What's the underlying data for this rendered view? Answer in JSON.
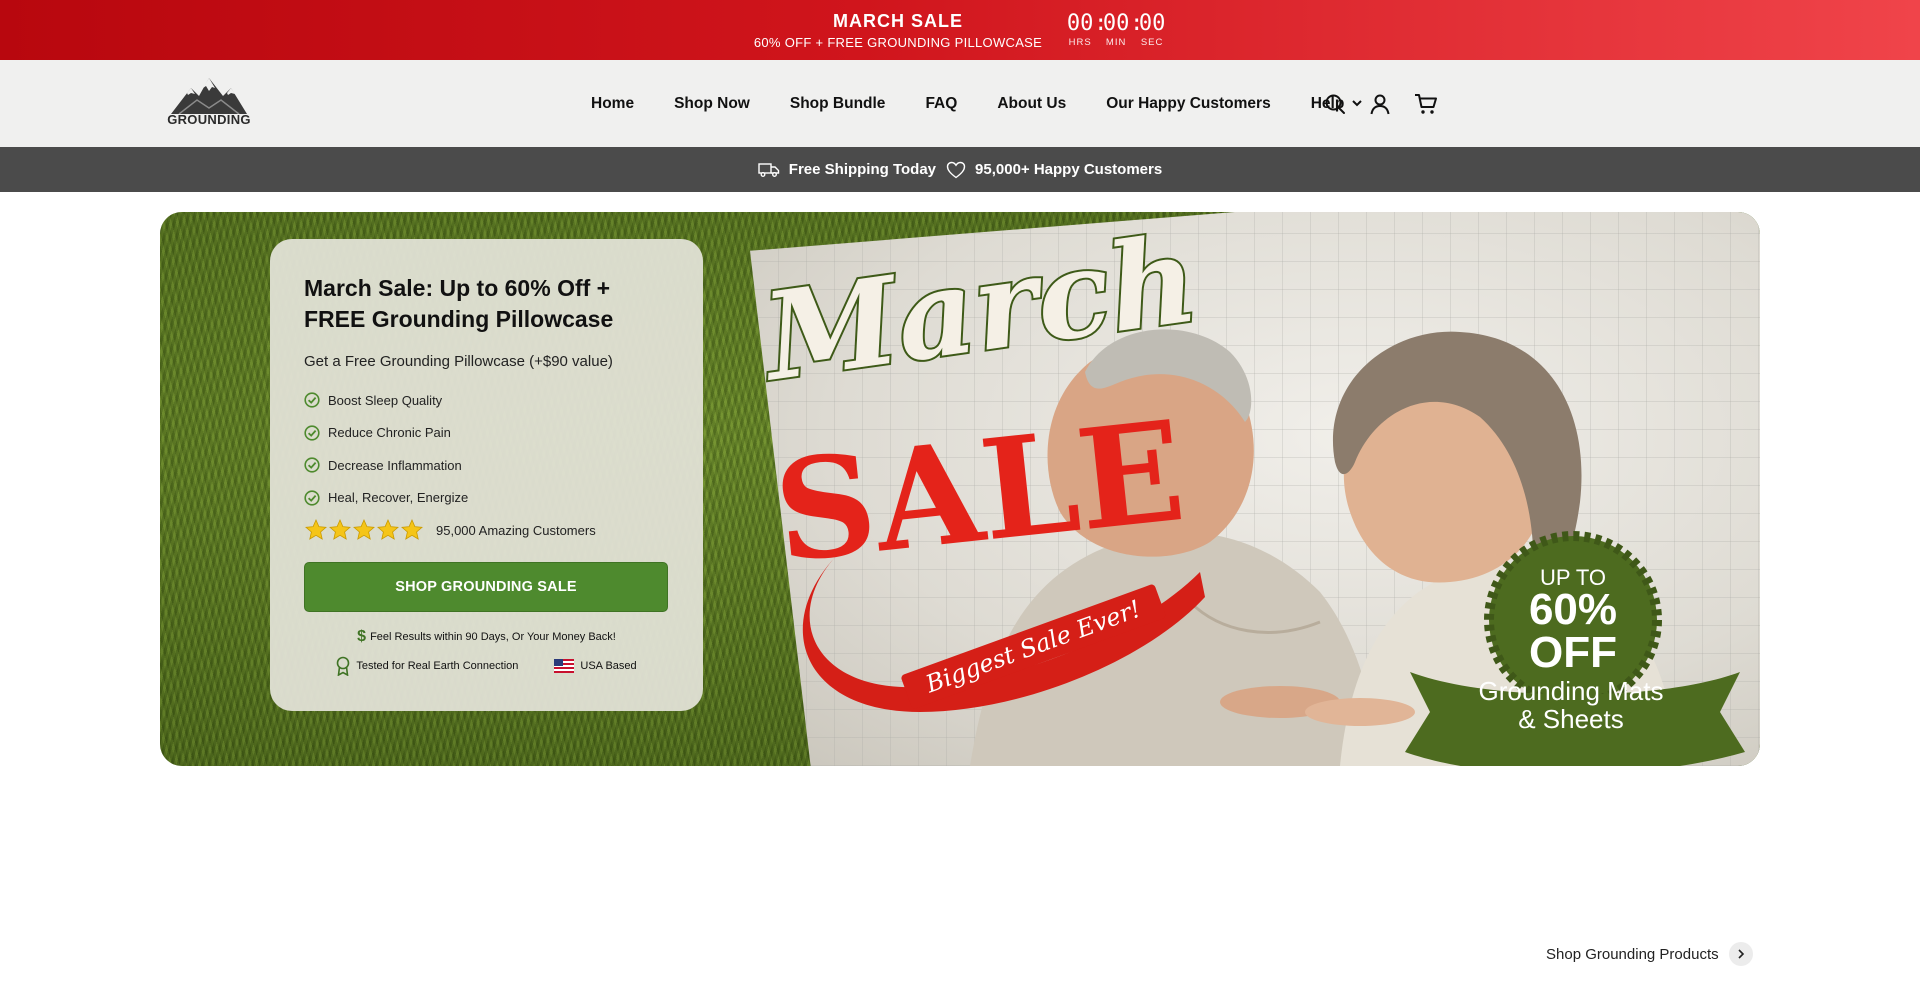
{
  "announcement": {
    "title": "MARCH SALE",
    "subtitle": "60% OFF + FREE GROUNDING PILLOWCASE",
    "countdown": {
      "hours": "00",
      "minutes": "00",
      "seconds": "00",
      "hours_label": "HRS",
      "minutes_label": "MIN",
      "seconds_label": "SEC"
    }
  },
  "header": {
    "logo_text": "GROUNDING",
    "nav": [
      "Home",
      "Shop Now",
      "Shop Bundle",
      "FAQ",
      "About Us",
      "Our Happy Customers",
      "Help"
    ],
    "icons": [
      "search-icon",
      "account-icon",
      "cart-icon"
    ]
  },
  "shipping_bar": {
    "shipping": "Free Shipping Today",
    "customers": "95,000+ Happy Customers"
  },
  "hero": {
    "card": {
      "title": "March Sale: Up to 60% Off + FREE Grounding Pillowcase",
      "subtitle": "Get a Free Grounding Pillowcase (+$90 value)",
      "benefits": [
        "Boost Sleep Quality",
        "Reduce Chronic Pain",
        "Decrease Inflammation",
        "Heal, Recover, Energize"
      ],
      "rating_stars": 5,
      "rating_text": "95,000 Amazing Customers",
      "cta": "SHOP GROUNDING SALE",
      "guarantee": "Feel Results within 90 Days, Or Your Money Back!",
      "badge_tested": "Tested for Real Earth Connection",
      "badge_usa": "USA Based"
    },
    "art": {
      "script_word": "March",
      "sale_word": "SALE",
      "ribbon_text": "Biggest Sale Ever!",
      "seal_line1": "UP TO",
      "seal_line2": "60%",
      "seal_line3": "OFF",
      "banner_line1": "Grounding Mats",
      "banner_line2": "& Sheets"
    },
    "colors": {
      "sale_red": "#e4231a",
      "brand_green": "#4e8a2e",
      "seal_green": "#4d6b1f"
    }
  },
  "bottom": {
    "shop_link": "Shop Grounding Products"
  }
}
